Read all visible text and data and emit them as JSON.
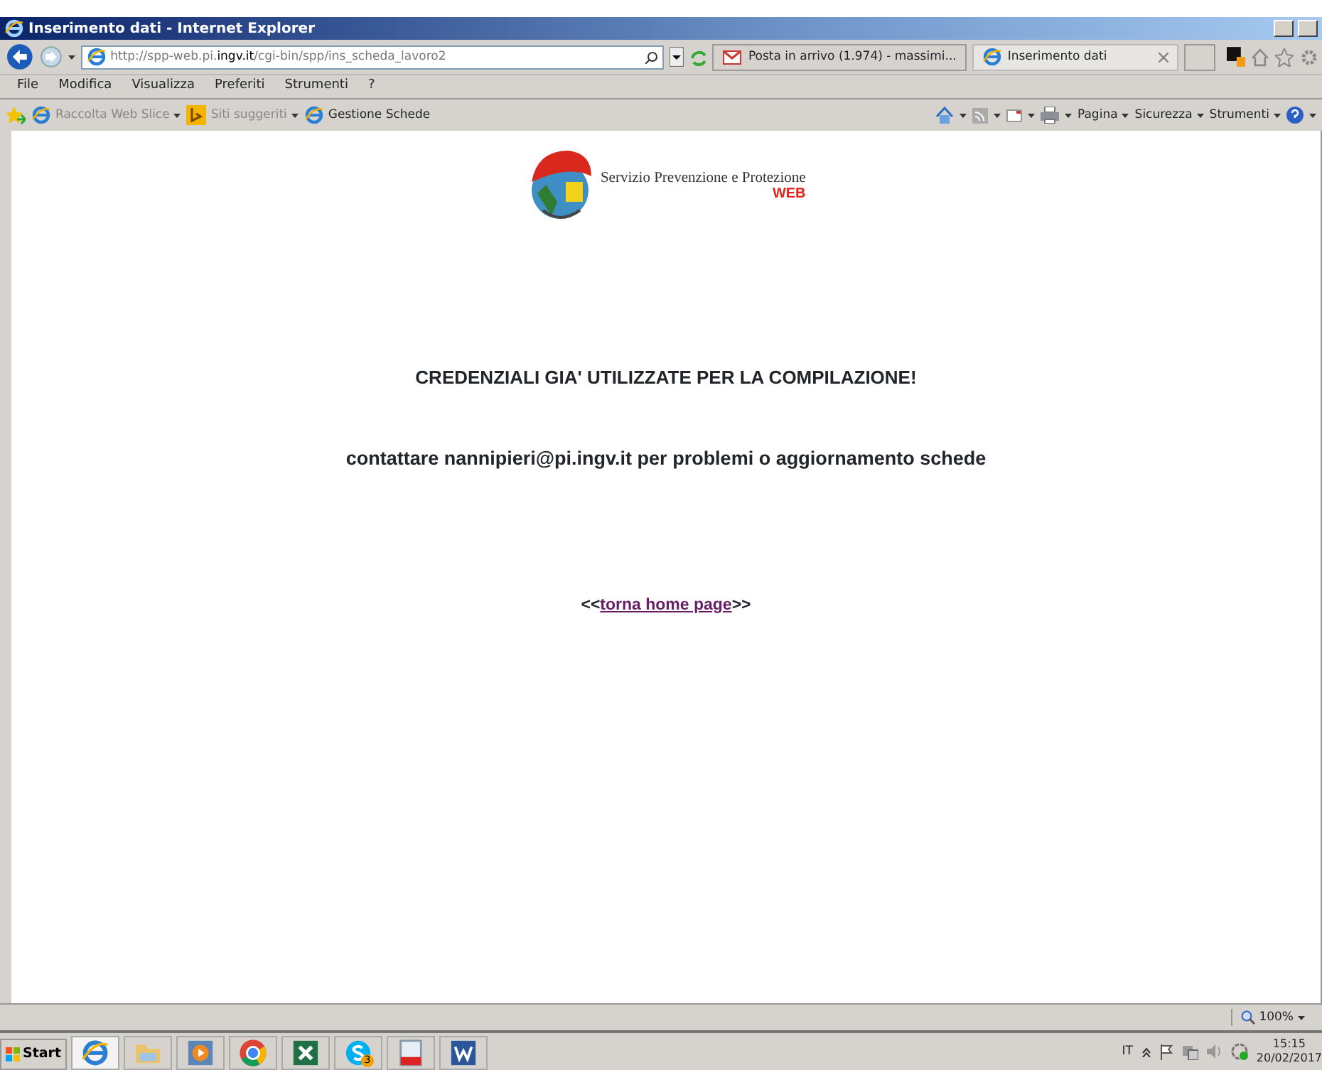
{
  "window": {
    "title": "Inserimento dati - Internet Explorer"
  },
  "address": {
    "url": "http://spp-web.pi.**ingv.it**/cgi-bin/spp/ins_scheda_lavoro2"
  },
  "tabs": [
    {
      "label": "Posta in arrivo (1.974) - massimi...",
      "kind": "mail",
      "selected": false
    },
    {
      "label": "Inserimento dati",
      "kind": "ie",
      "selected": true
    }
  ],
  "menu": [
    "File",
    "Modifica",
    "Visualizza",
    "Preferiti",
    "Strumenti",
    "?"
  ],
  "favorites": [
    {
      "label": "Raccolta Web Slice",
      "kind": "ie",
      "disabled": true,
      "dropdown": true
    },
    {
      "label": "Siti suggeriti",
      "kind": "bing",
      "disabled": true,
      "dropdown": true
    },
    {
      "label": "Gestione Schede",
      "kind": "ie",
      "disabled": false,
      "dropdown": false
    }
  ],
  "command_bar": [
    "Pagina",
    "Sicurezza",
    "Strumenti"
  ],
  "page": {
    "logo": {
      "title": "Servizio Prevenzione e Protezione",
      "subtitle": "WEB"
    },
    "heading": "CREDENZIALI GIA' UTILIZZATE PER LA COMPILAZIONE!",
    "message": "contattare nannipieri@pi.ingv.it per problemi o aggiornamento schede",
    "link": {
      "before": "<<",
      "label": "torna home page",
      "after": ">>"
    }
  },
  "status_bar": {
    "zoom": "100%"
  },
  "taskbar": {
    "start": "Start",
    "apps": [
      {
        "kind": "ie",
        "selected": true
      },
      {
        "kind": "folder",
        "selected": false
      },
      {
        "kind": "media",
        "selected": false
      },
      {
        "kind": "chrome",
        "selected": false
      },
      {
        "kind": "excel",
        "selected": false
      },
      {
        "kind": "skype",
        "selected": false,
        "badge": "3"
      },
      {
        "kind": "pdf",
        "selected": false
      },
      {
        "kind": "word",
        "selected": false
      }
    ],
    "language": "IT",
    "time": "15:15",
    "date": "20/02/2017"
  }
}
